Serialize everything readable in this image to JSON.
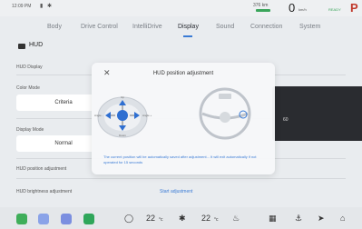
{
  "status": {
    "time": "12:09 PM",
    "signal_icon": "signal-icon",
    "bluetooth_icon": "bluetooth-icon",
    "range": "376 km",
    "speed": "0",
    "speed_unit": "km/h",
    "ready": "READY",
    "gear": "P"
  },
  "tabs": [
    {
      "label": "Body"
    },
    {
      "label": "Drive Control"
    },
    {
      "label": "IntelliDrive"
    },
    {
      "label": "Display"
    },
    {
      "label": "Sound"
    },
    {
      "label": "Connection"
    },
    {
      "label": "System"
    }
  ],
  "active_tab": "Display",
  "section": {
    "title": "HUD"
  },
  "settings": {
    "hud_display": "HUD Display",
    "color_mode_label": "Color Mode",
    "color_mode_value": "Criteria",
    "display_mode_label": "Display Mode",
    "display_mode_value": "Normal",
    "position_label": "HUD position adjustment",
    "brightness_label": "HUD brightness adjustment",
    "start_adjustment": "Start adjustment"
  },
  "dialog": {
    "title": "HUD position adjustment",
    "message": "The current position will be automatically saved after adjustment... It will exit automatically if not operated for 15 seconds",
    "labels": {
      "up": "Up",
      "down": "Down",
      "angle_minus": "Angle -",
      "angle_plus": "Angle +"
    }
  },
  "preview": {
    "speed": "60"
  },
  "dock": {
    "temp_left": "22",
    "temp_left_unit": "°c",
    "temp_right": "22",
    "temp_right_unit": "°c"
  },
  "colors": {
    "accent": "#3a7bd5",
    "gear": "#c0392b",
    "ready": "#3aa55b"
  }
}
